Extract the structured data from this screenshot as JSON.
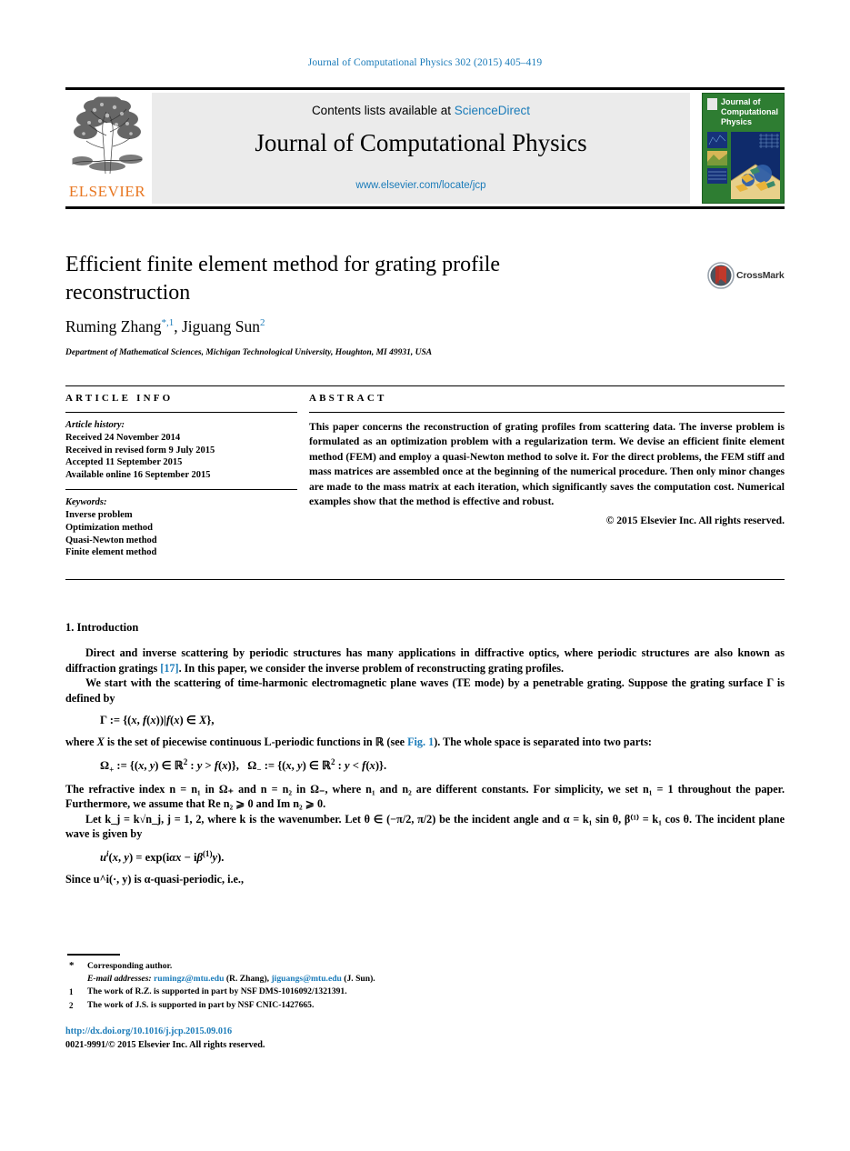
{
  "running_head": "Journal of Computational Physics 302 (2015) 405–419",
  "masthead": {
    "contents_prefix": "Contents lists available at ",
    "sciencedirect": "ScienceDirect",
    "journal_name": "Journal of Computational Physics",
    "journal_url": "www.elsevier.com/locate/jcp",
    "publisher": "ELSEVIER",
    "cover_title_line1": "Journal of",
    "cover_title_line2": "Computational",
    "cover_title_line3": "Physics"
  },
  "article": {
    "title": "Efficient finite element method for grating profile reconstruction",
    "crossmark_label": "CrossMark",
    "author1": "Ruming Zhang",
    "author1_marks": "*,1",
    "author2": ", Jiguang Sun",
    "author2_mark": "2",
    "affiliation": "Department of Mathematical Sciences, Michigan Technological University, Houghton, MI 49931, USA"
  },
  "info": {
    "heading": "ARTICLE INFO",
    "history_label": "Article history:",
    "history": [
      "Received 24 November 2014",
      "Received in revised form 9 July 2015",
      "Accepted 11 September 2015",
      "Available online 16 September 2015"
    ],
    "keywords_label": "Keywords:",
    "keywords": [
      "Inverse problem",
      "Optimization method",
      "Quasi-Newton method",
      "Finite element method"
    ]
  },
  "abstract": {
    "heading": "ABSTRACT",
    "text": "This paper concerns the reconstruction of grating profiles from scattering data. The inverse problem is formulated as an optimization problem with a regularization term. We devise an efficient finite element method (FEM) and employ a quasi-Newton method to solve it. For the direct problems, the FEM stiff and mass matrices are assembled once at the beginning of the numerical procedure. Then only minor changes are made to the mass matrix at each iteration, which significantly saves the computation cost. Numerical examples show that the method is effective and robust.",
    "copyright": "© 2015 Elsevier Inc. All rights reserved."
  },
  "body": {
    "section_heading": "1. Introduction",
    "para1_a": "Direct and inverse scattering by periodic structures has many applications in diffractive optics, where periodic structures are also known as diffraction gratings ",
    "para1_ref": "[17]",
    "para1_b": ". In this paper, we consider the inverse problem of reconstructing grating profiles.",
    "para2": "We start with the scattering of time-harmonic electromagnetic plane waves (TE mode) by a penetrable grating. Suppose the grating surface Γ is defined by",
    "para3_a": "where ",
    "para3_b": " is the set of piecewise continuous L-periodic functions in ",
    "para3_c": " (see ",
    "para3_ref": "Fig. 1",
    "para3_d": "). The whole space is separated into two parts:",
    "para4": "The refractive index n = n₁ in Ω₊ and n = n₂ in Ω₋, where n₁ and n₂ are different constants. For simplicity, we set n₁ = 1 throughout the paper. Furthermore, we assume that Re n₂ ⩾ 0 and Im n₂ ⩾ 0.",
    "para5": "Let k_j = k√n_j, j = 1, 2, where k is the wavenumber. Let θ ∈ (−π/2, π/2) be the incident angle and α = k₁ sin θ, β⁽¹⁾ = k₁ cos θ. The incident plane wave is given by",
    "para6": "Since u^i(·, y) is α-quasi-periodic, i.e.,"
  },
  "footnotes": {
    "star_mark": "*",
    "star_text": "Corresponding author.",
    "email_label": "E-mail addresses:",
    "email1": "rumingz@mtu.edu",
    "email1_who": "(R. Zhang),",
    "email2": "jiguangs@mtu.edu",
    "email2_who": "(J. Sun).",
    "fn1_mark": "1",
    "fn1_text": "The work of R.Z. is supported in part by NSF DMS-1016092/1321391.",
    "fn2_mark": "2",
    "fn2_text": "The work of J.S. is supported in part by NSF CNIC-1427665."
  },
  "footer": {
    "doi": "http://dx.doi.org/10.1016/j.jcp.2015.09.016",
    "issn_line": "0021-9991/© 2015 Elsevier Inc. All rights reserved."
  },
  "colors": {
    "link": "#1a7bb9",
    "elsevier_orange": "#E87722",
    "cover_green": "#2e7d32",
    "band_gray": "#ebebeb"
  }
}
